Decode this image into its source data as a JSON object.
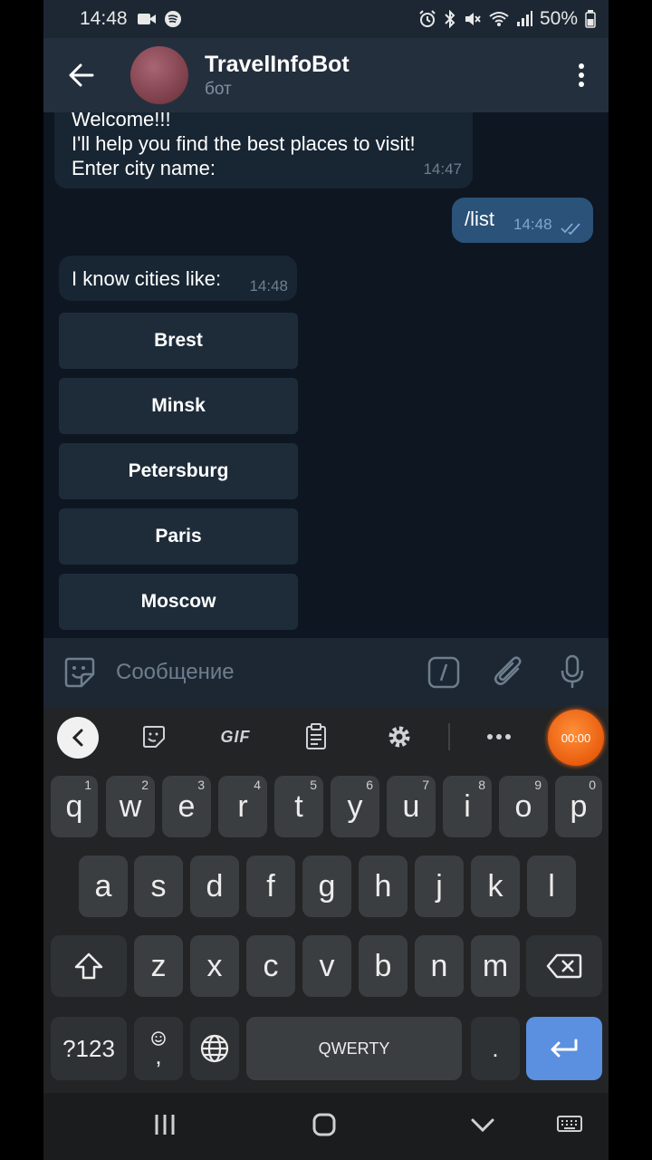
{
  "status_bar": {
    "time": "14:48",
    "battery": "50%"
  },
  "header": {
    "bot_name": "TravelInfoBot",
    "bot_status": "бот"
  },
  "messages": {
    "welcome": {
      "lines": [
        "Welcome!!!",
        "I'll help you find the best places to visit!",
        "Enter city name:"
      ],
      "time": "14:47"
    },
    "outgoing": {
      "text": "/list",
      "time": "14:48"
    },
    "cities_intro": {
      "text": "I know cities like:",
      "time": "14:48"
    }
  },
  "inline_keyboard": [
    "Brest",
    "Minsk",
    "Petersburg",
    "Paris",
    "Moscow"
  ],
  "input": {
    "placeholder": "Сообщение"
  },
  "keyboard_toolbar": {
    "gif": "GIF",
    "recorder": "00:00"
  },
  "keys": {
    "row1": [
      {
        "label": "q",
        "num": "1"
      },
      {
        "label": "w",
        "num": "2"
      },
      {
        "label": "e",
        "num": "3"
      },
      {
        "label": "r",
        "num": "4"
      },
      {
        "label": "t",
        "num": "5"
      },
      {
        "label": "y",
        "num": "6"
      },
      {
        "label": "u",
        "num": "7"
      },
      {
        "label": "i",
        "num": "8"
      },
      {
        "label": "o",
        "num": "9"
      },
      {
        "label": "p",
        "num": "0"
      }
    ],
    "row2": [
      "a",
      "s",
      "d",
      "f",
      "g",
      "h",
      "j",
      "k",
      "l"
    ],
    "row3": [
      "z",
      "x",
      "c",
      "v",
      "b",
      "n",
      "m"
    ],
    "symbols": "?123",
    "comma": ",",
    "space": "QWERTY",
    "period": "."
  },
  "colors": {
    "chat_bg": "#0e1621",
    "header_bg": "#242f3d",
    "incoming_bubble": "#182533",
    "outgoing_bubble": "#2b5278",
    "enter_key": "#5b8fe0",
    "recorder": "#e85a0a"
  }
}
